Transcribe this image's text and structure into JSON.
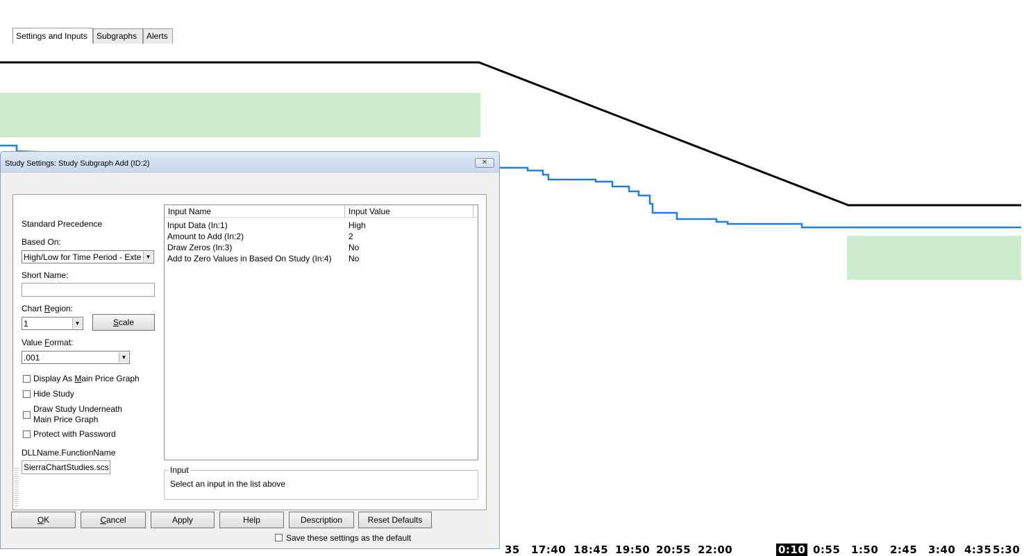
{
  "chart": {
    "time_labels": [
      "35",
      "17:40",
      "18:45",
      "19:50",
      "20:55",
      "22:00",
      "0:10",
      "0:55",
      "1:50",
      "2:45",
      "3:40",
      "4:35",
      "5:30"
    ],
    "highlighted_time_label": "0:10",
    "colors": {
      "price_line": "#000000",
      "subgraph_line": "#1e7fe0",
      "zone_fill": "#cdebcd"
    }
  },
  "dialog": {
    "title": "Study Settings: Study Subgraph Add (ID:2)",
    "close_icon": "close-icon",
    "tabs": [
      {
        "label": "Settings and Inputs",
        "active": true
      },
      {
        "label": "Subgraphs",
        "active": false
      },
      {
        "label": "Alerts",
        "active": false
      }
    ],
    "left": {
      "precedence_label": "Standard Precedence",
      "based_on_label": "Based On:",
      "based_on_value": "High/Low for Time Period - Exte",
      "short_name_label": "Short Name:",
      "short_name_value": "",
      "chart_region_label_pre": "Chart ",
      "chart_region_label_u": "R",
      "chart_region_label_post": "egion:",
      "chart_region_value": "1",
      "scale_u": "S",
      "scale_rest": "cale",
      "value_format_label_pre": "Value ",
      "value_format_label_u": "F",
      "value_format_label_post": "ormat:",
      "value_format_value": ".001",
      "display_main_pre": "Display As ",
      "display_main_u": "M",
      "display_main_post": "ain Price Graph",
      "hide_study": "Hide Study",
      "draw_under_line1": "Draw Study Underneath",
      "draw_under_line2": "Main Price Graph",
      "protect": "Protect with Password",
      "dll_label": "DLLName.FunctionName",
      "dll_value": "SierraChartStudies.scs"
    },
    "inputs_list": {
      "columns": [
        "Input Name",
        "Input Value"
      ],
      "rows": [
        {
          "name": "Input Data  (In:1)",
          "value": "High"
        },
        {
          "name": "Amount to Add  (In:2)",
          "value": "2"
        },
        {
          "name": "Draw Zeros  (In:3)",
          "value": "No"
        },
        {
          "name": "Add to Zero Values in Based On Study  (In:4)",
          "value": "No"
        }
      ]
    },
    "input_group": {
      "title": "Input",
      "text": "Select an input in the list above"
    },
    "buttons": {
      "ok_u": "O",
      "ok_rest": "K",
      "cancel_u": "C",
      "cancel_rest": "ancel",
      "apply": "Apply",
      "help": "Help",
      "description": "Description",
      "reset": "Reset Defaults"
    },
    "save_default": "Save these settings as the default"
  }
}
